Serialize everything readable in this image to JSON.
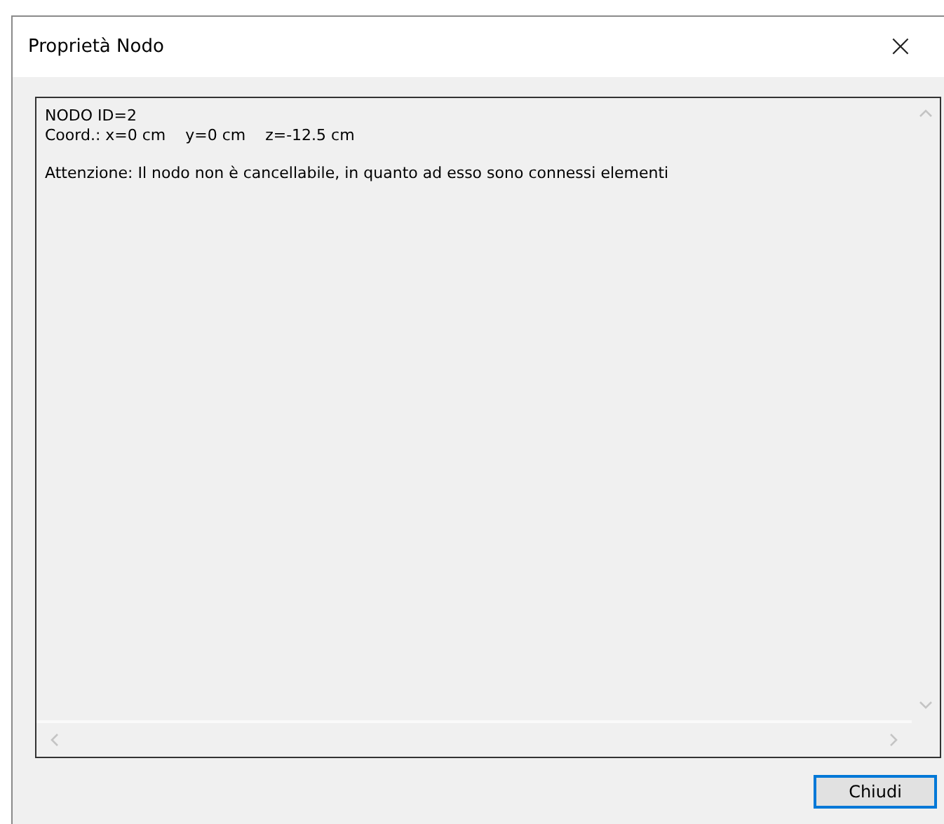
{
  "window": {
    "title": "Proprietà Nodo",
    "close_glyph": "×"
  },
  "text_area": {
    "paragraphs": [
      [
        "NODO ID=2",
        "Coord.: x=0 cm    y=0 cm    z=-12.5 cm"
      ],
      [
        "Attenzione: Il nodo non è cancellabile, in quanto ad esso sono connessi elementi"
      ]
    ]
  },
  "buttons": [
    {
      "label": "Chiudi",
      "default": true
    }
  ]
}
